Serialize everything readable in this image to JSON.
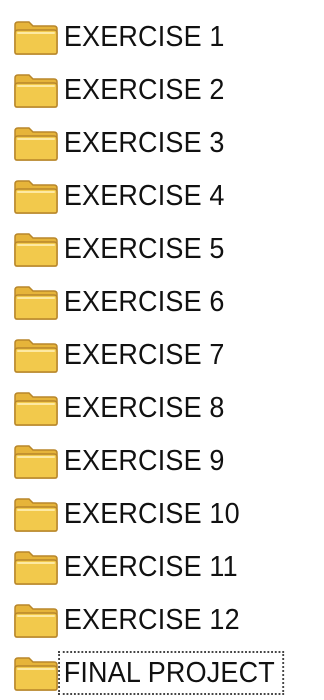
{
  "folders": [
    {
      "label": "EXERCISE 1",
      "icon": "folder-icon"
    },
    {
      "label": "EXERCISE 2",
      "icon": "folder-icon"
    },
    {
      "label": "EXERCISE 3",
      "icon": "folder-icon"
    },
    {
      "label": "EXERCISE 4",
      "icon": "folder-icon"
    },
    {
      "label": "EXERCISE 5",
      "icon": "folder-icon"
    },
    {
      "label": "EXERCISE 6",
      "icon": "folder-icon"
    },
    {
      "label": "EXERCISE 7",
      "icon": "folder-icon"
    },
    {
      "label": "EXERCISE 8",
      "icon": "folder-icon"
    },
    {
      "label": "EXERCISE 9",
      "icon": "folder-icon"
    },
    {
      "label": "EXERCISE 10",
      "icon": "folder-icon"
    },
    {
      "label": "EXERCISE 11",
      "icon": "folder-icon"
    },
    {
      "label": "EXERCISE 12",
      "icon": "folder-icon"
    },
    {
      "label": "FINAL PROJECT",
      "icon": "folder-icon",
      "focused": true
    }
  ],
  "colors": {
    "folder_body": "#f2c94c",
    "folder_back": "#e6b43a",
    "folder_outline": "#b8862a",
    "folder_highlight": "#fde9a2",
    "text": "#111111",
    "focus_outline": "#444444"
  }
}
